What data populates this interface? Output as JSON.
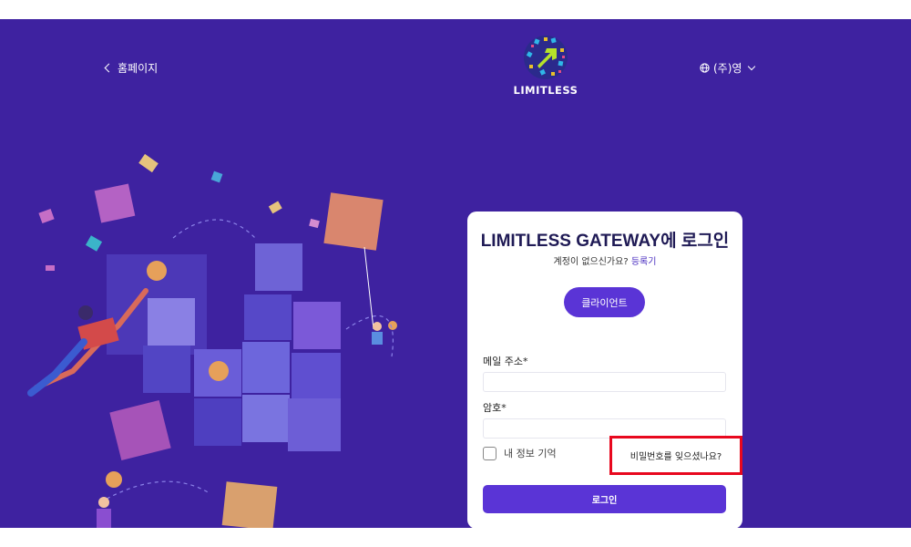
{
  "header": {
    "back_label": "홈페이지",
    "logo_text": "LIMITLESS",
    "language_label": "(주)영"
  },
  "login_card": {
    "title": "LIMITLESS GATEWAY에 로그인",
    "no_account_text": "계정이 없으신가요?",
    "register_link": "등록기",
    "client_button": "클라이언트",
    "email_label": "메일 주소*",
    "email_value": "",
    "password_label": "암호*",
    "password_value": "",
    "remember_label": "내 정보 기억",
    "forgot_link": "비밀번호를 잊으셨나요?",
    "login_button": "로그인"
  },
  "colors": {
    "background": "#3e22a0",
    "accent": "#5a34d6",
    "highlight_box": "#e8081e"
  },
  "icons": [
    "chevron-left-icon",
    "globe-icon",
    "chevron-down-icon",
    "limitless-logo-icon"
  ]
}
